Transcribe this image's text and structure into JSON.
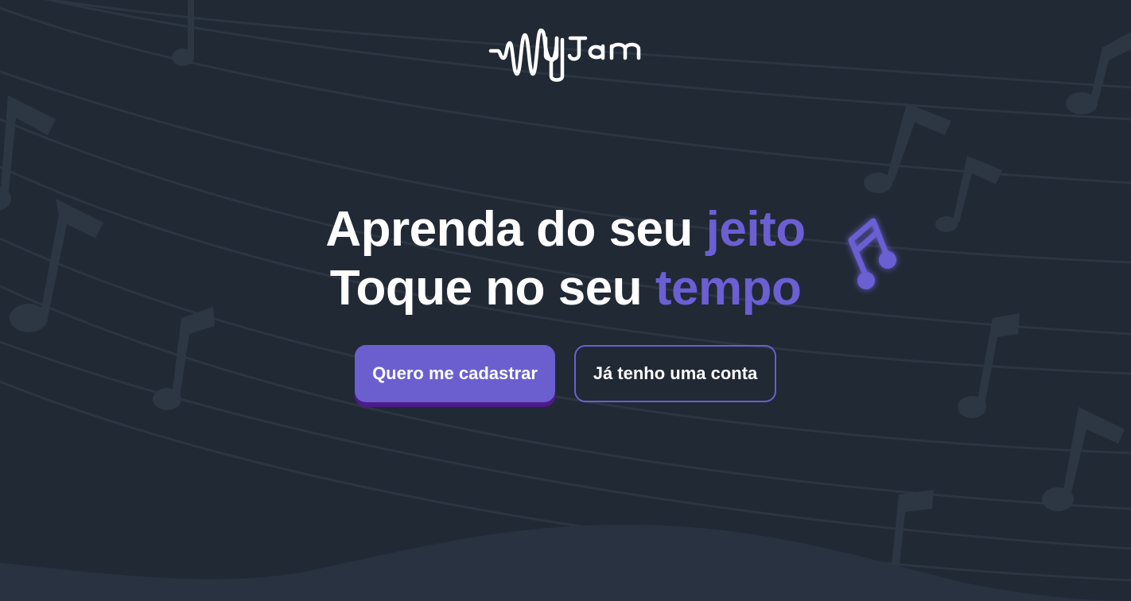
{
  "brand": {
    "logo_text": "MyJam"
  },
  "hero": {
    "line1_prefix": "Aprenda do seu ",
    "line1_accent": "jeito",
    "line2_prefix": "Toque no seu ",
    "line2_accent": "tempo"
  },
  "actions": {
    "signup_label": "Quero me cadastrar",
    "login_label": "Já tenho uma conta"
  },
  "colors": {
    "background": "#212934",
    "accent": "#6b5fd3",
    "primary_button": "#6b5fd0",
    "primary_button_shadow": "#4e1b8a",
    "staff_lines": "#2c3542",
    "decor_notes": "#2d3643",
    "bottom_wave": "#283241"
  },
  "icons": {
    "decor": "music-note-icon",
    "hero": "glowing-music-note-icon"
  }
}
